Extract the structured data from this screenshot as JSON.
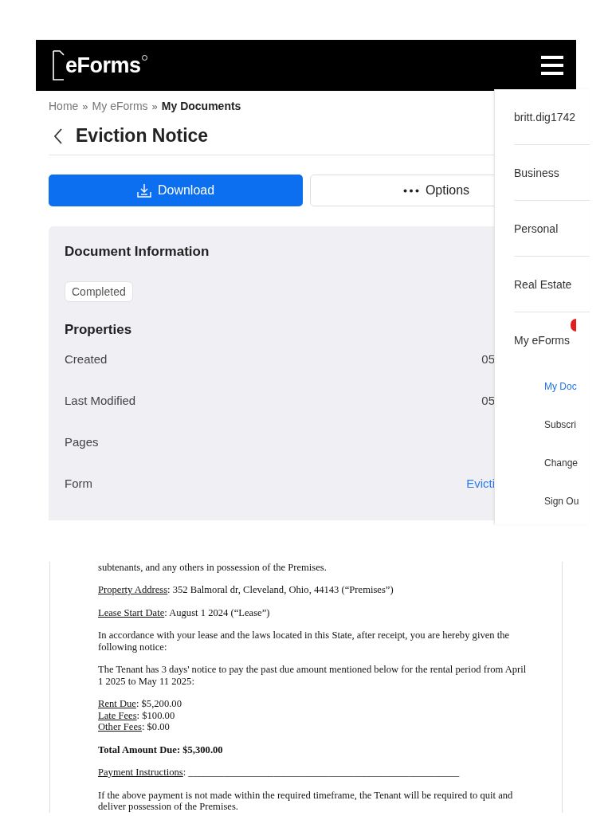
{
  "header": {
    "logo": "eForms"
  },
  "breadcrumb": [
    {
      "label": "Home",
      "selected": false
    },
    {
      "label": "My eForms",
      "selected": false
    },
    {
      "label": "My Documents",
      "selected": true
    }
  ],
  "breadcrumb_separator": "»",
  "title": "Eviction Notice",
  "buttons": [
    {
      "kind": "download",
      "label": "Download"
    },
    {
      "kind": "options",
      "label": "Options"
    }
  ],
  "document_information": {
    "heading": "Document Information",
    "status": "Completed",
    "properties_heading": "Properties",
    "properties": [
      {
        "label": "Created",
        "value": "05",
        "kind": "text"
      },
      {
        "label": "Last Modified",
        "value": "05",
        "kind": "text"
      },
      {
        "label": "Pages",
        "kind": "text"
      },
      {
        "label": "Form",
        "value": "Evicti",
        "kind": "link"
      }
    ]
  },
  "menu": {
    "items": [
      {
        "label": "britt.dig1742",
        "badge": false
      },
      {
        "label": "Business",
        "badge": false
      },
      {
        "label": "Personal",
        "badge": false
      },
      {
        "label": "Real Estate",
        "badge": false
      },
      {
        "label": "My eForms",
        "badge": true,
        "children": [
          {
            "label": "My Doc",
            "selected": true
          },
          {
            "label": "Subscri",
            "selected": false
          },
          {
            "label": "Change",
            "selected": false
          },
          {
            "label": "Sign Ou",
            "selected": false
          }
        ]
      }
    ]
  },
  "document_preview": [
    {
      "kind": "plain",
      "text": "subtenants, and any others in possession of the Premises."
    },
    {
      "kind": "field",
      "label": "Property Address",
      "text": ": 352 Balmoral dr, Cleveland, Ohio, 44143 (“Premises”)"
    },
    {
      "kind": "field",
      "label": "Lease Start Date",
      "text": ": August 1 2024 (“Lease”)"
    },
    {
      "kind": "plain",
      "text": "In accordance with your lease and the laws located in this State, after receipt, you are hereby given the following notice:"
    },
    {
      "kind": "plain",
      "text": "The Tenant has 3 days' notice to pay the past due amount mentioned below for the rental period from April 1 2025 to May 11 2025:"
    },
    {
      "kind": "fees",
      "lines": [
        {
          "label": "Rent Due",
          "text": ": $5,200.00"
        },
        {
          "label": "Late Fees",
          "text": ": $100.00"
        },
        {
          "label": "Other Fees",
          "text": ": $0.00"
        }
      ]
    },
    {
      "kind": "bold",
      "text": "Total Amount Due: $5,300.00"
    },
    {
      "kind": "field",
      "label": "Payment Instructions",
      "text": ": ______________________________________________________"
    },
    {
      "kind": "plain",
      "text": "If the above payment is not made within the required timeframe, the Tenant will be required to quit and deliver possession of the Premises."
    }
  ]
}
